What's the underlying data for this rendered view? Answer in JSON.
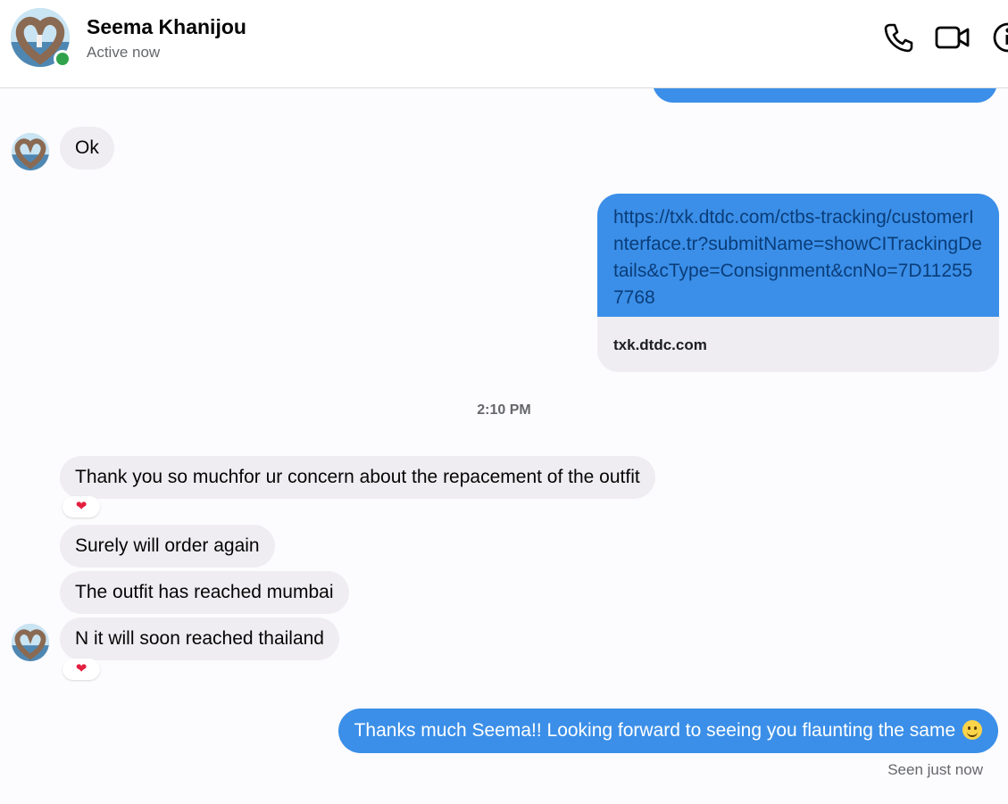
{
  "header": {
    "name": "Seema Khanijou",
    "status": "Active now",
    "icons": [
      "phone-icon",
      "video-camera-icon",
      "info-icon"
    ]
  },
  "messages": {
    "ok": "Ok",
    "link_url": "https://txk.dtdc.com/ctbs-tracking/customerInterface.tr?submitName=showCITrackingDetails&cType=Consignment&cnNo=7D112557768",
    "link_domain": "txk.dtdc.com",
    "timestamp": "2:10 PM",
    "msg1": "Thank you so muchfor ur concern about the repacement of the outfit",
    "msg1_reaction": "❤",
    "msg2": "Surely will order again",
    "msg3": "The outfit has reached mumbai",
    "msg4": "N it will soon reached thailand",
    "msg4_reaction": "❤",
    "reply": "Thanks much Seema!! Looking forward to seeing you flaunting the same",
    "seen": "Seen just now"
  },
  "colors": {
    "outgoing_bubble": "#3b8fe8",
    "incoming_bubble": "#efedf1",
    "online": "#31a24c"
  }
}
